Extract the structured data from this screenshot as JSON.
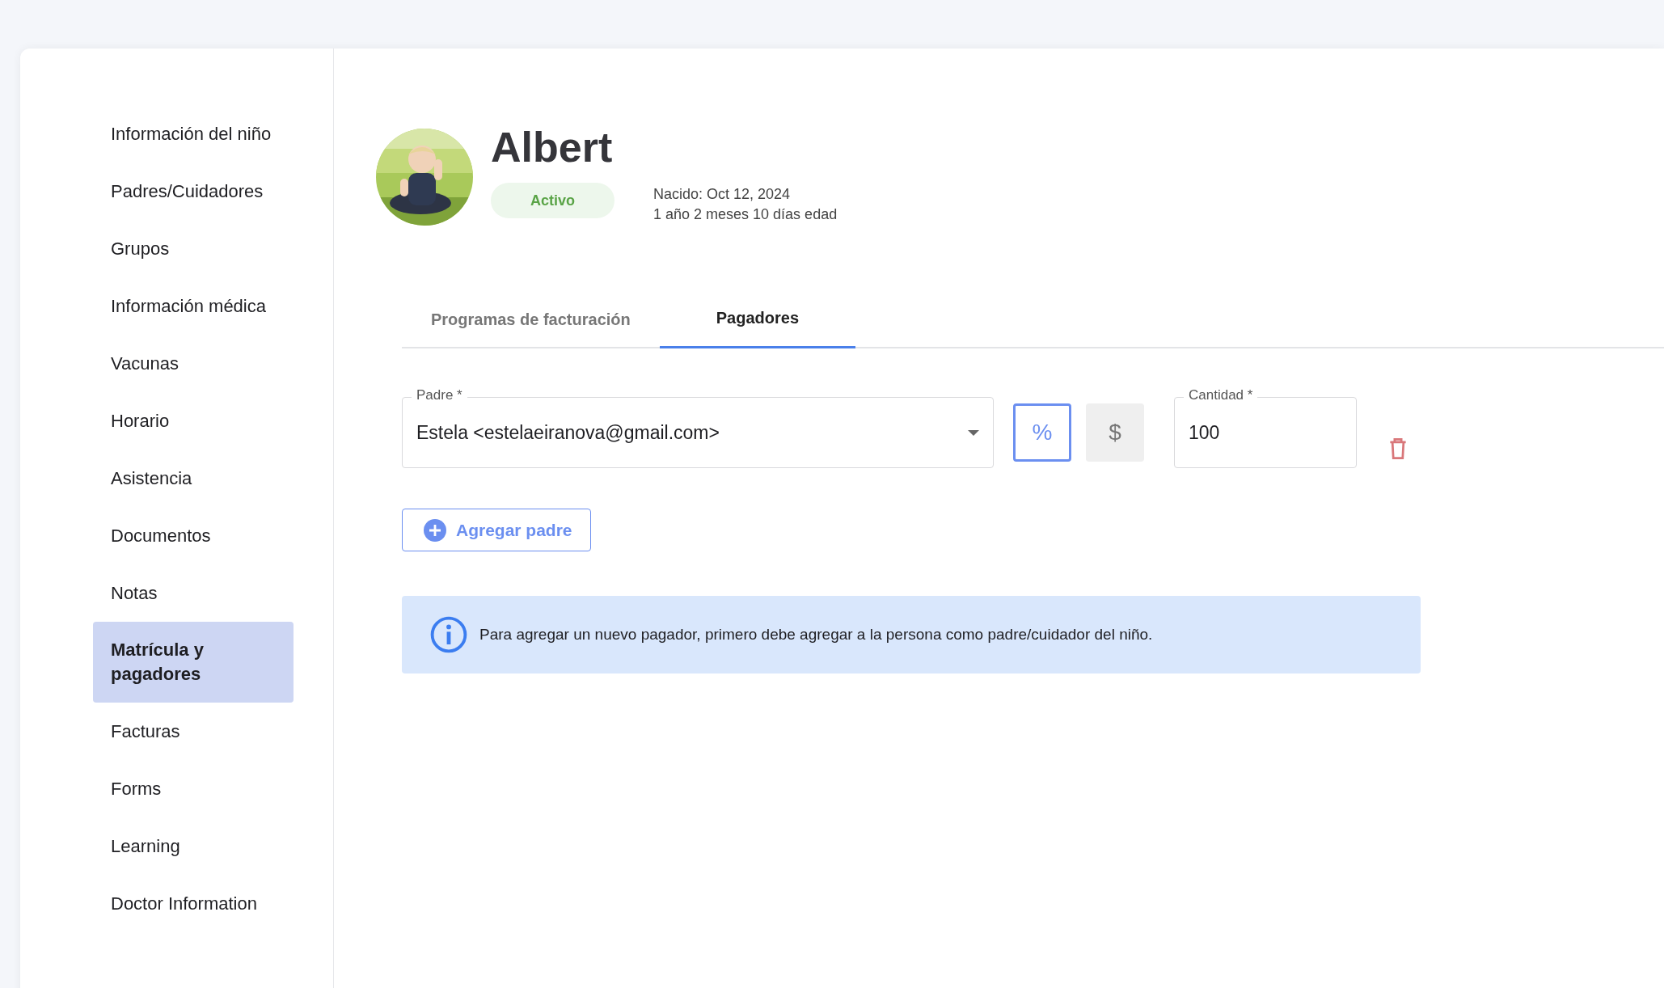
{
  "sidebar": {
    "items": [
      {
        "label": "Información del niño",
        "selected": false
      },
      {
        "label": "Padres/Cuidadores",
        "selected": false
      },
      {
        "label": "Grupos",
        "selected": false
      },
      {
        "label": "Información médica",
        "selected": false
      },
      {
        "label": "Vacunas",
        "selected": false
      },
      {
        "label": "Horario",
        "selected": false
      },
      {
        "label": "Asistencia",
        "selected": false
      },
      {
        "label": "Documentos",
        "selected": false
      },
      {
        "label": "Notas",
        "selected": false
      },
      {
        "label": "Matrícula y pagadores",
        "selected": true
      },
      {
        "label": "Facturas",
        "selected": false
      },
      {
        "label": "Forms",
        "selected": false
      },
      {
        "label": "Learning",
        "selected": false
      },
      {
        "label": "Doctor Information",
        "selected": false
      }
    ]
  },
  "profile": {
    "name": "Albert",
    "status": "Activo",
    "born": "Nacido: Oct 12, 2024",
    "age": "1 año 2 meses 10 días edad"
  },
  "tabs": [
    {
      "label": "Programas de facturación",
      "selected": false
    },
    {
      "label": "Pagadores",
      "selected": true
    }
  ],
  "payer": {
    "parent_label": "Padre *",
    "parent_value": "Estela <estelaeiranova@gmail.com>",
    "units": [
      {
        "symbol": "%",
        "selected": true
      },
      {
        "symbol": "$",
        "selected": false
      }
    ],
    "amount_label": "Cantidad *",
    "amount_value": "100"
  },
  "add_button": "Agregar padre",
  "info": "Para agregar un nuevo pagador, primero debe agregar a la persona como padre/cuidador del niño."
}
